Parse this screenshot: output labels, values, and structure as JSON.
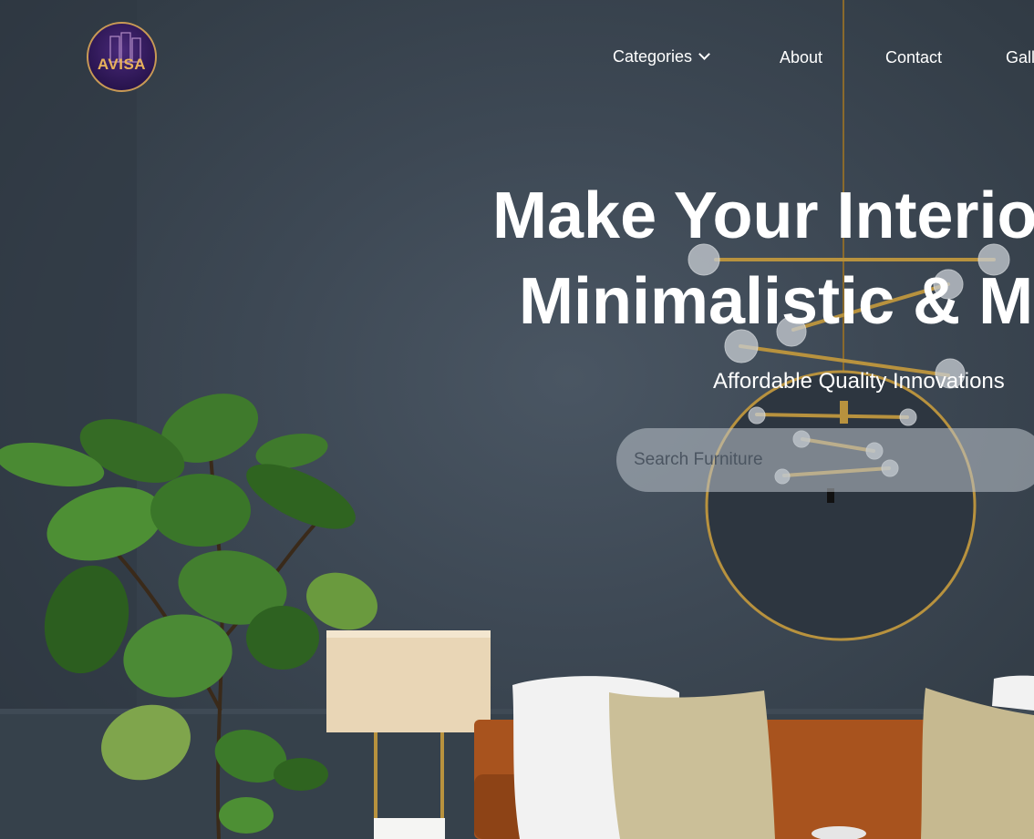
{
  "brand": {
    "logo_text": "AVISA"
  },
  "nav": {
    "categories_label": "Categories",
    "about_label": "About",
    "contact_label": "Contact",
    "gallery_label": "Gall"
  },
  "hero": {
    "headline_line1": "Make Your Interio",
    "headline_line2": "Minimalistic & M",
    "tagline": "Affordable Quality Innovations",
    "search_placeholder": "Search Furniture"
  },
  "colors": {
    "wall": "#3d4854",
    "brass": "#b8923e",
    "logo_bg": "#2a1550",
    "logo_gold": "#e9b25b"
  }
}
